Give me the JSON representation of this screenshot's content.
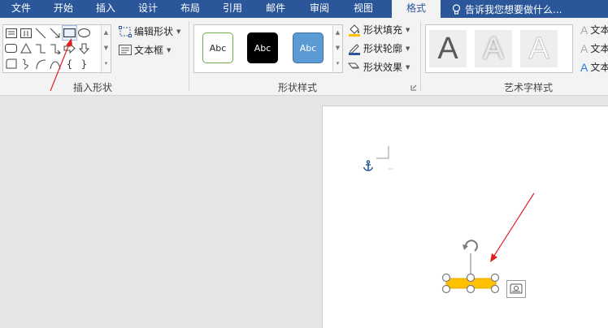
{
  "tabs": [
    {
      "label": "文件",
      "active": false
    },
    {
      "label": "开始",
      "active": false
    },
    {
      "label": "插入",
      "active": false
    },
    {
      "label": "设计",
      "active": false
    },
    {
      "label": "布局",
      "active": false
    },
    {
      "label": "引用",
      "active": false
    },
    {
      "label": "邮件",
      "active": false
    },
    {
      "label": "审阅",
      "active": false
    },
    {
      "label": "视图",
      "active": false
    },
    {
      "label": "格式",
      "active": true
    }
  ],
  "tell_me": {
    "icon": "lightbulb-icon",
    "text": "告诉我您想要做什么..."
  },
  "groups": {
    "insert_shapes": {
      "label": "插入形状",
      "edit_shape": "编辑形状",
      "text_box": "文本框",
      "selected_shape": "rectangle"
    },
    "shape_styles": {
      "label": "形状样式",
      "swatches": [
        {
          "text": "Abc",
          "fill": "#ffffff",
          "border": "#70ad47",
          "color": "#262626"
        },
        {
          "text": "Abc",
          "fill": "#000000",
          "border": "#000000",
          "color": "#ffffff"
        },
        {
          "text": "Abc",
          "fill": "#5b9bd5",
          "border": "#41719c",
          "color": "#ffffff"
        }
      ],
      "fill": "形状填充",
      "outline": "形状轮廓",
      "effects": "形状效果"
    },
    "wordart": {
      "label": "艺术字样式",
      "letters": [
        "A",
        "A",
        "A"
      ],
      "cmd1": "文本",
      "cmd2": "文本",
      "cmd3": "文本"
    }
  },
  "document": {
    "shape_fill": "#ffc000",
    "anchor_icon": "anchor-icon",
    "layout_options_icon": "layout-options-icon"
  },
  "colors": {
    "tab_bar": "#2b579a",
    "ribbon": "#f3f3f3",
    "workspace": "#e6e6e6",
    "annotation_arrow": "#e02020"
  }
}
